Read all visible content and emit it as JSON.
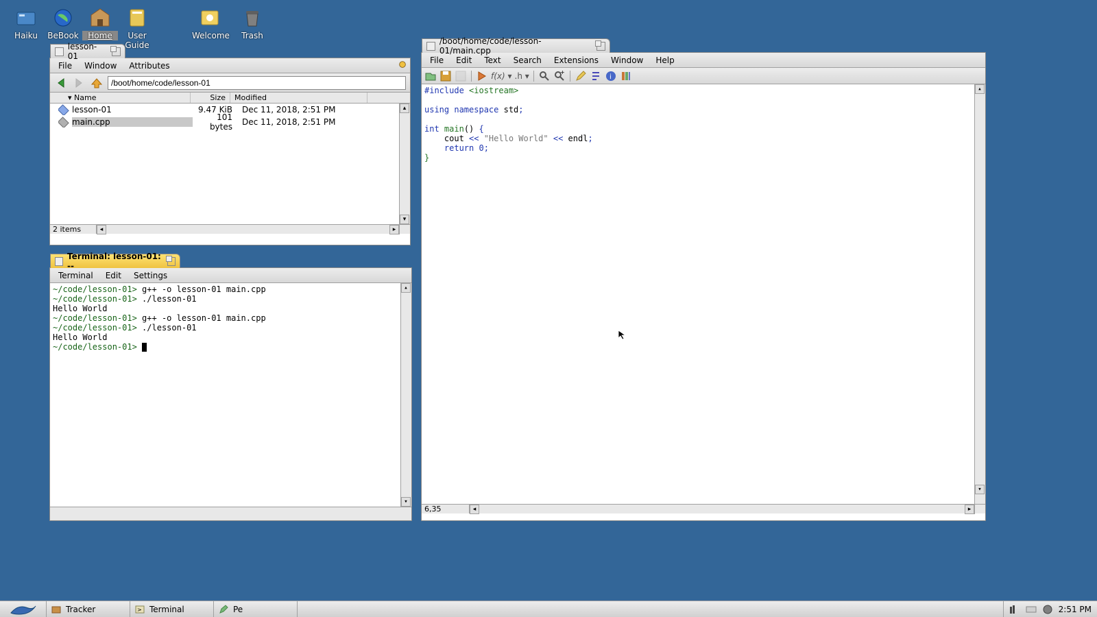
{
  "desktop": {
    "icons": [
      {
        "name": "haiku-icon",
        "label": "Haiku"
      },
      {
        "name": "bebook-icon",
        "label": "BeBook"
      },
      {
        "name": "home-icon",
        "label": "Home"
      },
      {
        "name": "userguide-icon",
        "label": "User Guide"
      },
      {
        "name": "welcome-icon",
        "label": "Welcome"
      },
      {
        "name": "trash-icon",
        "label": "Trash"
      }
    ]
  },
  "tracker": {
    "title": "lesson-01",
    "menus": [
      "File",
      "Window",
      "Attributes"
    ],
    "path": "/boot/home/code/lesson-01",
    "cols": {
      "name": "Name",
      "size": "Size",
      "modified": "Modified"
    },
    "files": [
      {
        "name": "lesson-01",
        "size": "9.47 KiB",
        "modified": "Dec 11, 2018, 2:51 PM"
      },
      {
        "name": "main.cpp",
        "size": "101 bytes",
        "modified": "Dec 11, 2018, 2:51 PM"
      }
    ],
    "status": "2 items"
  },
  "terminal": {
    "title": "Terminal: lesson-01: --",
    "menus": [
      "Terminal",
      "Edit",
      "Settings"
    ],
    "lines": [
      {
        "prompt": "~/code/lesson-01>",
        "cmd": " g++ -o lesson-01 main.cpp"
      },
      {
        "prompt": "~/code/lesson-01>",
        "cmd": " ./lesson-01"
      },
      {
        "out": "Hello World"
      },
      {
        "prompt": "~/code/lesson-01>",
        "cmd": " g++ -o lesson-01 main.cpp"
      },
      {
        "prompt": "~/code/lesson-01>",
        "cmd": " ./lesson-01"
      },
      {
        "out": "Hello World"
      },
      {
        "prompt": "~/code/lesson-01>",
        "cmd": " "
      }
    ]
  },
  "editor": {
    "title": "/boot/home/code/lesson-01/main.cpp",
    "menus": [
      "File",
      "Edit",
      "Text",
      "Search",
      "Extensions",
      "Window",
      "Help"
    ],
    "status": "6,35",
    "code": {
      "l1a": "#include",
      "l1b": " <iostream>",
      "l3a": "using",
      "l3b": " namespace",
      "l3c": " std",
      "l3d": ";",
      "l5a": "int",
      "l5b": " main",
      "l5c": "()",
      "l5d": " {",
      "l6a": "    cout ",
      "l6b": "<<",
      "l6c": " \"Hello World\" ",
      "l6d": "<<",
      "l6e": " endl",
      "l6f": ";",
      "l7a": "    ",
      "l7b": "return",
      "l7c": " 0",
      "l7d": ";",
      "l8": "}"
    }
  },
  "deskbar": {
    "tasks": [
      {
        "name": "tracker-task",
        "label": "Tracker"
      },
      {
        "name": "terminal-task",
        "label": "Terminal"
      },
      {
        "name": "pe-task",
        "label": "Pe"
      }
    ],
    "clock": "2:51 PM"
  }
}
